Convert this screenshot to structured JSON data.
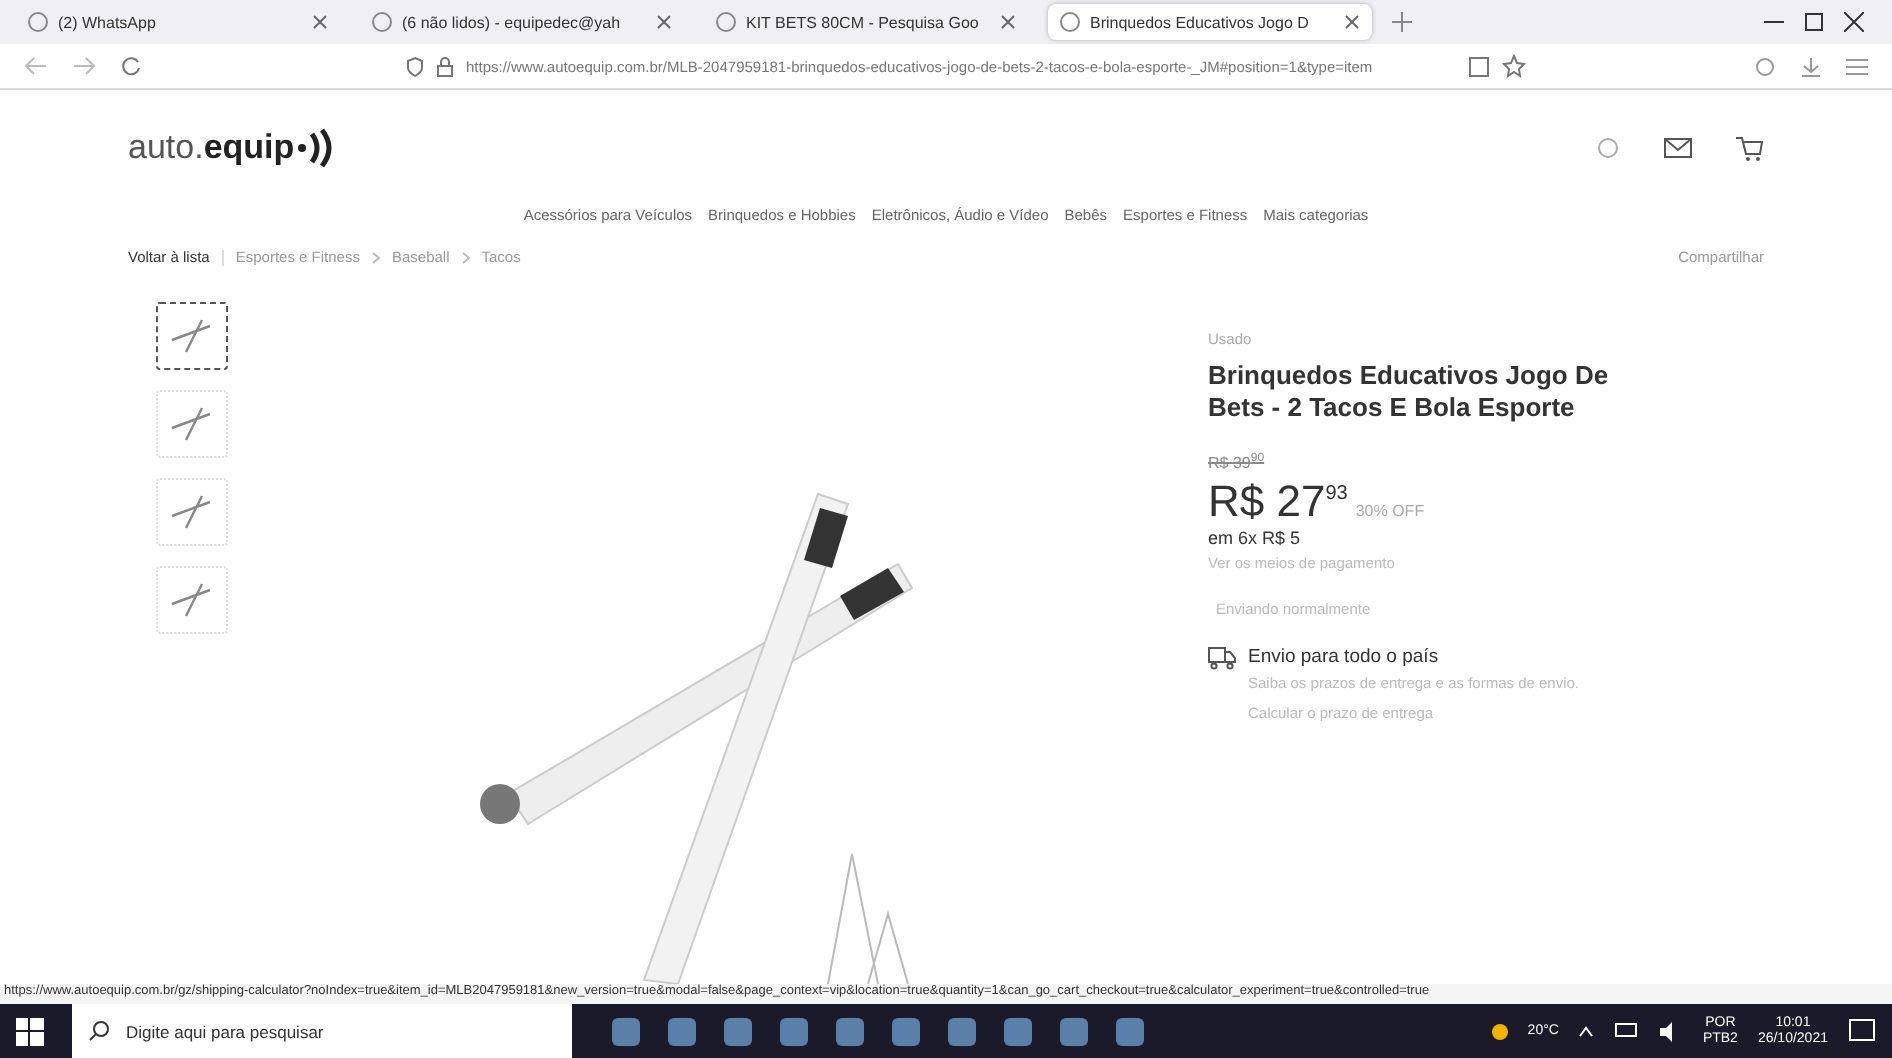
{
  "browser": {
    "tabs": [
      {
        "label": "(2) WhatsApp",
        "selected": false
      },
      {
        "label": "(6 não lidos) - equipedec@yah",
        "selected": false
      },
      {
        "label": "KIT BETS 80CM - Pesquisa Goo",
        "selected": false
      },
      {
        "label": "Brinquedos Educativos Jogo D",
        "selected": true
      }
    ],
    "url": "https://www.autoequip.com.br/MLB-2047959181-brinquedos-educativos-jogo-de-bets-2-tacos-e-bola-esporte-_JM#position=1&type=item"
  },
  "site": {
    "logo_light": "auto.",
    "logo_bold": "equip",
    "categories": [
      "Acessórios para Veículos",
      "Brinquedos e Hobbies",
      "Eletrônicos, Áudio e Vídeo",
      "Bebês",
      "Esportes e Fitness",
      "Mais categorias"
    ]
  },
  "breadcrumb": {
    "back": "Voltar à lista",
    "path": [
      "Esportes e Fitness",
      "Baseball",
      "Tacos"
    ],
    "share": "Compartilhar"
  },
  "gallery": {
    "thumbnails": [
      {
        "selected": true
      },
      {
        "selected": false
      },
      {
        "selected": false
      },
      {
        "selected": false
      }
    ]
  },
  "product": {
    "condition": "Usado",
    "title": "Brinquedos Educativos Jogo De Bets - 2 Tacos E Bola Esporte",
    "old_price": "R$ 39$^{90}$",
    "price": "R$ 27$^{93}$",
    "discount": "30% OFF",
    "installments": "em 6x R$ 5",
    "payment_link": "Ver os meios de pagamento",
    "stock": "Enviando normalmente",
    "shipping_title": "Envio para todo o país",
    "shipping_text": "Saiba os prazos de entrega e as formas de envio.",
    "shipping_link": "Calcular o prazo de entrega"
  },
  "status_url": "https://www.autoequip.com.br/gz/shipping-calculator?noIndex=true&item_id=MLB2047959181&new_version=true&modal=false&page_context=vip&location=true&quantity=1&can_go_cart_checkout=true&calculator_experiment=true&controlled=true",
  "taskbar": {
    "search_placeholder": "Digite aqui para pesquisar",
    "temperature": "20°C",
    "language": "POR",
    "layout": "PTB2",
    "time": "10:01",
    "date": "26/10/2021"
  }
}
